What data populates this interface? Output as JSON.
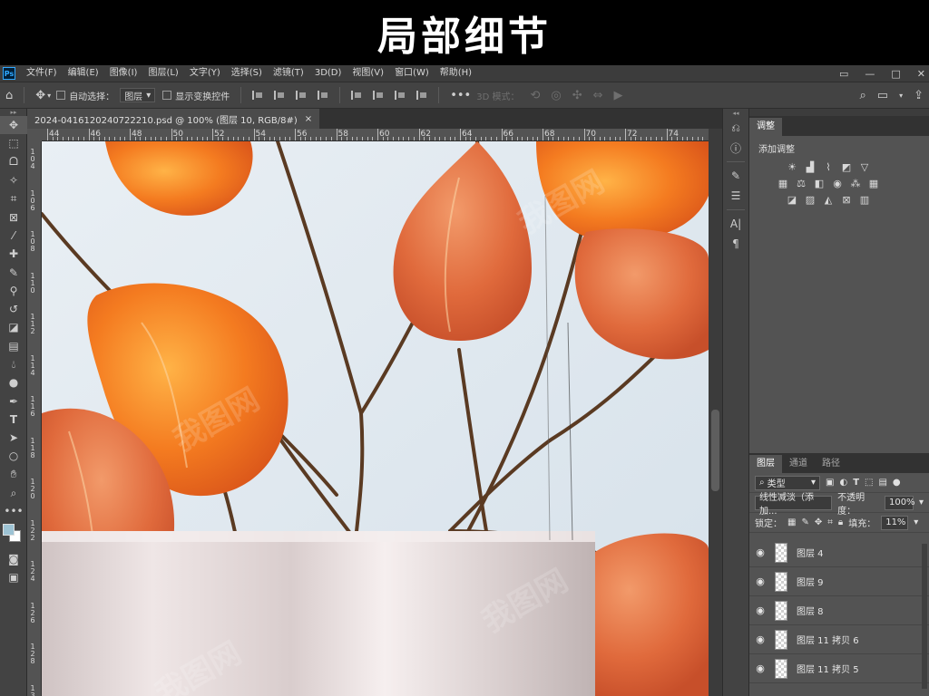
{
  "banner": {
    "title": "局部细节"
  },
  "app": {
    "logo": "Ps"
  },
  "menubar": {
    "items": [
      "文件(F)",
      "编辑(E)",
      "图像(I)",
      "图层(L)",
      "文字(Y)",
      "选择(S)",
      "滤镜(T)",
      "3D(D)",
      "视图(V)",
      "窗口(W)",
      "帮助(H)"
    ],
    "window_controls": [
      "▭",
      "—",
      "□",
      "✕"
    ]
  },
  "options": {
    "auto_select_label": "自动选择：",
    "auto_select_value": "图层",
    "show_transform_label": "显示变换控件",
    "mode_3d_label": "3D 模式："
  },
  "document": {
    "tab_title": "2024-0416120240722210.psd @ 100% (图层 10, RGB/8#)",
    "close": "×"
  },
  "ruler": {
    "h_labels": [
      "44",
      "46",
      "48",
      "50",
      "52",
      "54",
      "56",
      "58",
      "60",
      "62",
      "64",
      "66",
      "68",
      "70",
      "72",
      "74"
    ],
    "v_labels": [
      [
        "1",
        "0",
        "4"
      ],
      [
        "1",
        "0",
        "6"
      ],
      [
        "1",
        "0",
        "8"
      ],
      [
        "1",
        "1",
        "0"
      ],
      [
        "1",
        "1",
        "2"
      ],
      [
        "1",
        "1",
        "4"
      ],
      [
        "1",
        "1",
        "6"
      ],
      [
        "1",
        "1",
        "8"
      ],
      [
        "1",
        "2",
        "0"
      ],
      [
        "1",
        "2",
        "2"
      ],
      [
        "1",
        "2",
        "4"
      ],
      [
        "1",
        "2",
        "6"
      ],
      [
        "1",
        "2",
        "8"
      ],
      [
        "1",
        "3",
        "0"
      ]
    ]
  },
  "adjustments": {
    "tab": "调整",
    "title": "添加调整"
  },
  "layers": {
    "tabs": [
      "图层",
      "通道",
      "路径"
    ],
    "filter_label": "类型",
    "blend_mode": "线性减淡（添加...",
    "opacity_label": "不透明度：",
    "opacity_value": "100%",
    "lock_label": "锁定：",
    "fill_label": "填充：",
    "fill_value": "11%",
    "items": [
      {
        "name": "图层 4"
      },
      {
        "name": "图层 9"
      },
      {
        "name": "图层 8"
      },
      {
        "name": "图层 11 拷贝 6"
      },
      {
        "name": "图层 11 拷贝 5"
      }
    ]
  },
  "watermark": "我图网",
  "colors": {
    "foreground": "#9dc3d4",
    "background": "#ffffff",
    "canvas_bg": "#e3ebf1",
    "lantern_orange": "#f07a2a"
  }
}
